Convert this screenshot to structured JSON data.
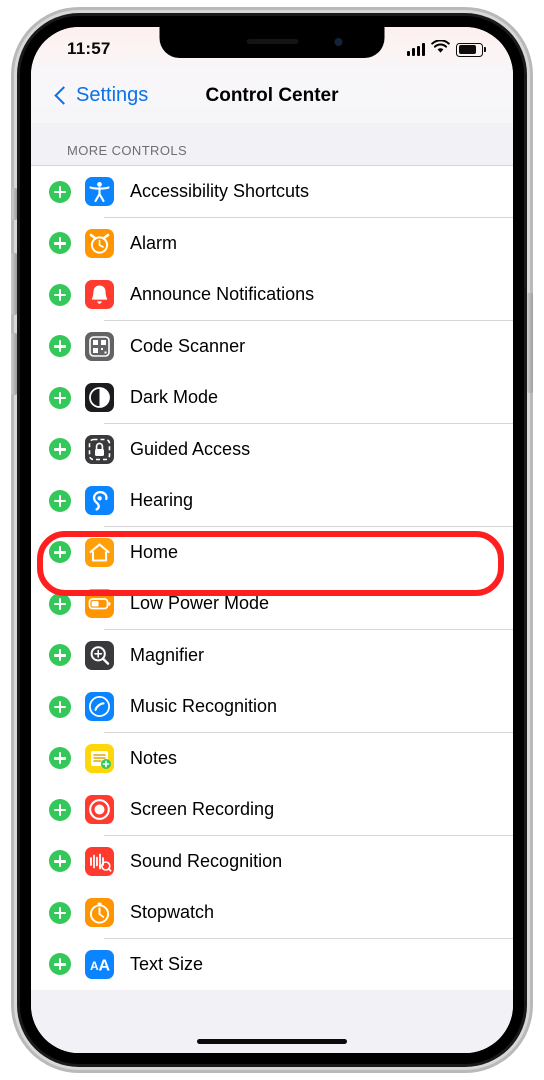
{
  "status_bar": {
    "time": "11:57",
    "signal_icon": "cellular-signal-icon",
    "wifi_icon": "wifi-icon",
    "battery_icon": "battery-icon"
  },
  "nav": {
    "back_label": "Settings",
    "title": "Control Center"
  },
  "section": {
    "header": "MORE CONTROLS"
  },
  "colors": {
    "add_green": "#34c759",
    "tint_blue": "#0b72e7",
    "highlight_red": "#ff1f1f"
  },
  "rows": [
    {
      "label": "Accessibility Shortcuts",
      "icon": "accessibility-icon",
      "icon_bg": "#0a84ff",
      "glyph": "accessibility"
    },
    {
      "label": "Alarm",
      "icon": "alarm-clock-icon",
      "icon_bg": "#ff9500",
      "glyph": "clock"
    },
    {
      "label": "Announce Notifications",
      "icon": "announce-notifications-icon",
      "icon_bg": "#ff3b30",
      "glyph": "bell"
    },
    {
      "label": "Code Scanner",
      "icon": "code-scanner-icon",
      "icon_bg": "#636366",
      "glyph": "qr"
    },
    {
      "label": "Dark Mode",
      "icon": "dark-mode-icon",
      "icon_bg": "#1c1c1e",
      "glyph": "contrast"
    },
    {
      "label": "Guided Access",
      "icon": "guided-access-icon",
      "icon_bg": "#3a3a3c",
      "glyph": "lock"
    },
    {
      "label": "Hearing",
      "icon": "hearing-icon",
      "icon_bg": "#0a84ff",
      "glyph": "ear"
    },
    {
      "label": "Home",
      "icon": "home-icon",
      "icon_bg": "#ff9f0a",
      "glyph": "house"
    },
    {
      "label": "Low Power Mode",
      "icon": "low-power-mode-icon",
      "icon_bg": "#ff9500",
      "glyph": "battery"
    },
    {
      "label": "Magnifier",
      "icon": "magnifier-icon",
      "icon_bg": "#3a3a3c",
      "glyph": "magnify"
    },
    {
      "label": "Music Recognition",
      "icon": "music-recognition-icon",
      "icon_bg": "#0a84ff",
      "glyph": "shazam"
    },
    {
      "label": "Notes",
      "icon": "notes-icon",
      "icon_bg": "#ffd60a",
      "glyph": "note"
    },
    {
      "label": "Screen Recording",
      "icon": "screen-recording-icon",
      "icon_bg": "#ff3b30",
      "glyph": "record"
    },
    {
      "label": "Sound Recognition",
      "icon": "sound-recognition-icon",
      "icon_bg": "#ff3b30",
      "glyph": "waveform"
    },
    {
      "label": "Stopwatch",
      "icon": "stopwatch-icon",
      "icon_bg": "#ff9500",
      "glyph": "stopwatch"
    },
    {
      "label": "Text Size",
      "icon": "text-size-icon",
      "icon_bg": "#0a84ff",
      "glyph": "aa"
    }
  ],
  "highlight": {
    "target_label": "Hearing"
  }
}
